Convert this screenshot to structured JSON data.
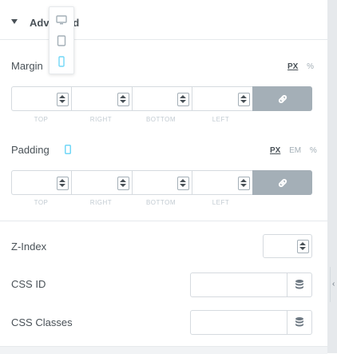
{
  "section": {
    "title": "Advanced"
  },
  "device_switcher": {
    "items": [
      "desktop-icon",
      "tablet-icon",
      "mobile-icon"
    ],
    "active": "mobile-icon"
  },
  "margin": {
    "label": "Margin",
    "units": [
      "PX",
      "%"
    ],
    "active_unit": "PX",
    "values": [
      "",
      "",
      "",
      ""
    ],
    "dim_labels": [
      "TOP",
      "RIGHT",
      "BOTTOM",
      "LEFT"
    ]
  },
  "padding": {
    "label": "Padding",
    "units": [
      "PX",
      "EM",
      "%"
    ],
    "active_unit": "PX",
    "values": [
      "",
      "",
      "",
      ""
    ],
    "dim_labels": [
      "TOP",
      "RIGHT",
      "BOTTOM",
      "LEFT"
    ]
  },
  "z_index": {
    "label": "Z-Index",
    "value": ""
  },
  "css_id": {
    "label": "CSS ID",
    "value": ""
  },
  "css_classes": {
    "label": "CSS Classes",
    "value": ""
  },
  "colors": {
    "accent": "#71d7f7",
    "link_button": "#a4afb7",
    "text": "#495157"
  }
}
